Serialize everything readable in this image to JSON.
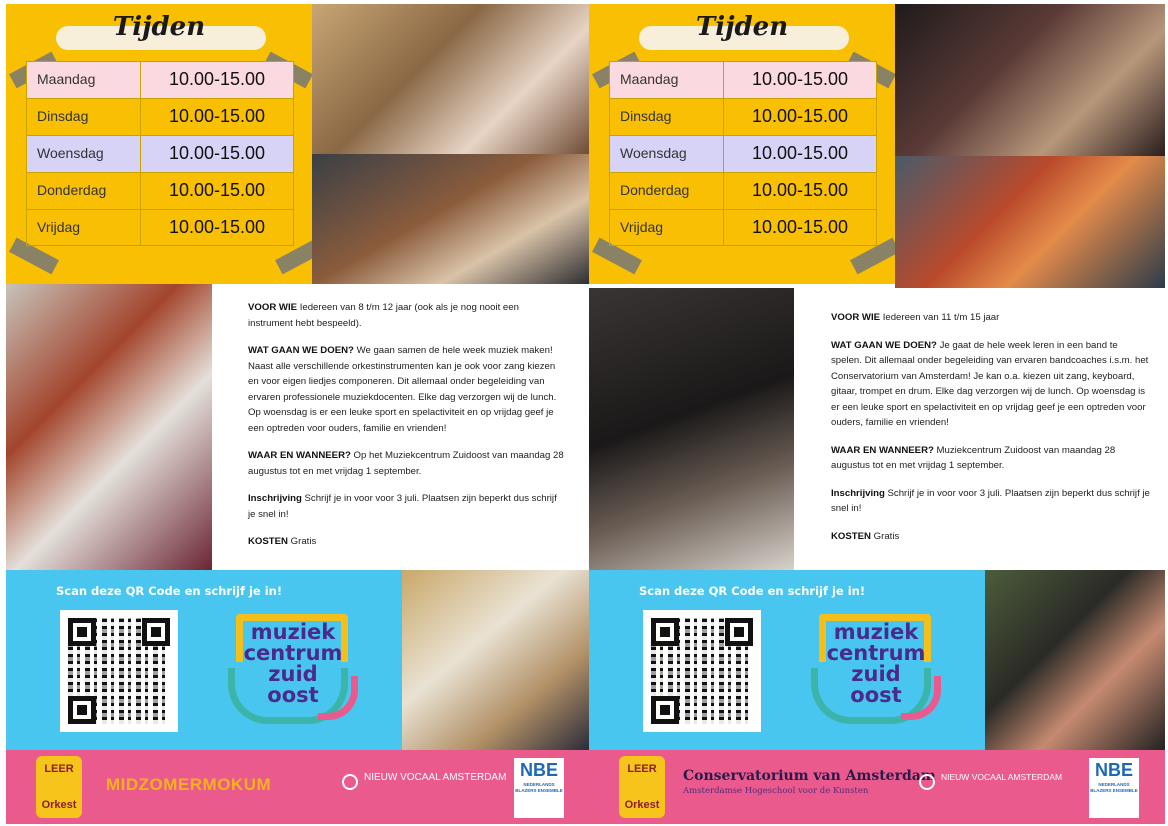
{
  "colors": {
    "yellow": "#f9c003",
    "cyan": "#48c6ef",
    "pink": "#ea5a8d",
    "purple": "#4a2b8c"
  },
  "schedule": {
    "title": "Tijden",
    "rows": [
      {
        "day": "Maandag",
        "hours": "10.00-15.00"
      },
      {
        "day": "Dinsdag",
        "hours": "10.00-15.00"
      },
      {
        "day": "Woensdag",
        "hours": "10.00-15.00"
      },
      {
        "day": "Donderdag",
        "hours": "10.00-15.00"
      },
      {
        "day": "Vrijdag",
        "hours": "10.00-15.00"
      }
    ]
  },
  "left": {
    "voor_wie_label": "VOOR WIE",
    "voor_wie": "Iedereen van 8 t/m 12 jaar (ook als je nog nooit een instrument hebt bespeeld).",
    "wat_label": "WAT GAAN WE DOEN?",
    "wat": "We gaan samen de hele week muziek maken! Naast alle verschillende orkestinstrumenten kan je ook voor zang kiezen en voor eigen liedjes componeren. Dit allemaal onder begeleiding van ervaren professionele muziekdocenten. Elke dag verzorgen wij de lunch. Op woensdag is er een leuke sport en spelactiviteit en op vrijdag geef je een optreden voor ouders, familie en vrienden!",
    "waar_label": "WAAR EN WANNEER?",
    "waar": "Op het Muziekcentrum Zuidoost van maandag 28 augustus tot en met vrijdag 1 september.",
    "inschrijving_label": "Inschrijving",
    "inschrijving": "Schrijf je in voor voor 3 juli. Plaatsen zijn beperkt dus schrijf je snel in!",
    "kosten_label": "KOSTEN",
    "kosten": "Gratis"
  },
  "right": {
    "voor_wie_label": "VOOR WIE",
    "voor_wie": "Iedereen van 11 t/m 15 jaar",
    "wat_label": "WAT GAAN WE DOEN?",
    "wat": "Je gaat de hele week leren in een band te spelen. Dit allemaal onder begeleiding van ervaren bandcoaches i.s.m. het Conservatorium van Amsterdam! Je kan o.a. kiezen uit zang, keyboard, gitaar, trompet en drum. Elke dag verzorgen wij de lunch. Op woensdag is er een leuke sport en spelactiviteit en op vrijdag geef je een optreden voor ouders, familie en vrienden!",
    "waar_label": "WAAR EN WANNEER?",
    "waar": "Muziekcentrum Zuidoost van maandag 28 augustus tot en met vrijdag 1 september.",
    "inschrijving_label": "Inschrijving",
    "inschrijving": "Schrijf je in voor voor 3 juli. Plaatsen zijn beperkt dus schrijf je snel in!",
    "kosten_label": "KOSTEN",
    "kosten": "Gratis"
  },
  "qr_cta": "Scan deze QR Code en schrijf je in!",
  "logo": {
    "line1": "muziek",
    "line2": "centrum",
    "line3": "zuid",
    "line4": "oost"
  },
  "sponsors": {
    "leer_orkest_top": "LEER",
    "leer_orkest_bottom": "Orkest",
    "midzomer": "MIDZOMERMOKUM",
    "nieuw_vocaal": "NIEUW VOCAAL AMSTERDAM",
    "nbe": "NBE",
    "nbe_sub": "NEDERLANDS BLAZERS ENSEMBLE",
    "conservatorium": "Conservatorium van Amsterdam",
    "conservatorium_sub": "Amsterdamse Hogeschool voor de Kunsten"
  }
}
